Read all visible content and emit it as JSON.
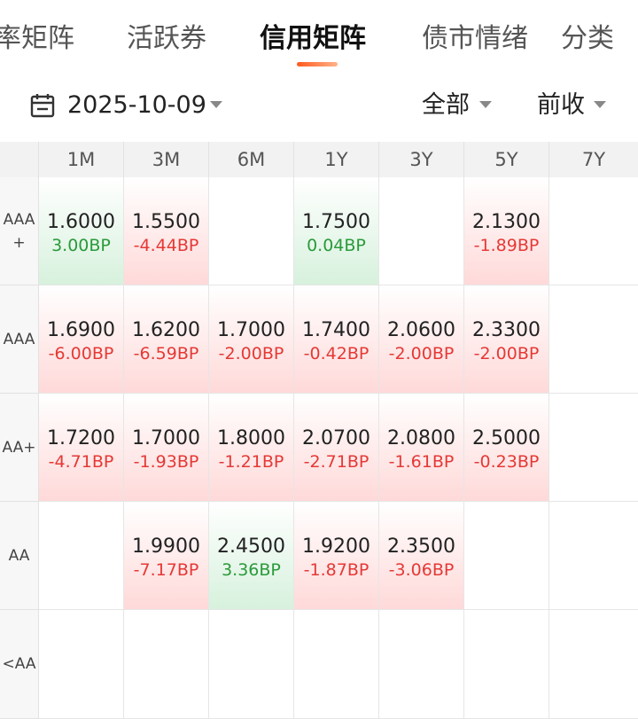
{
  "tabs": [
    {
      "label": "率矩阵",
      "active": false
    },
    {
      "label": "活跃券",
      "active": false
    },
    {
      "label": "信用矩阵",
      "active": true
    },
    {
      "label": "债市情绪",
      "active": false
    },
    {
      "label": "分类",
      "active": false
    }
  ],
  "filter": {
    "date": "2025-10-09",
    "scope": "全部",
    "compare": "前收"
  },
  "columns": [
    "1M",
    "3M",
    "6M",
    "1Y",
    "3Y",
    "5Y",
    "7Y"
  ],
  "rows": [
    {
      "label_line1": "AAA",
      "label_line2": "+",
      "cells": [
        {
          "value": "1.6000",
          "bp": "3.00BP",
          "trend": "green"
        },
        {
          "value": "1.5500",
          "bp": "-4.44BP",
          "trend": "red"
        },
        {
          "value": "",
          "bp": "",
          "trend": "none"
        },
        {
          "value": "1.7500",
          "bp": "0.04BP",
          "trend": "green"
        },
        {
          "value": "",
          "bp": "",
          "trend": "none"
        },
        {
          "value": "2.1300",
          "bp": "-1.89BP",
          "trend": "red"
        },
        {
          "value": "",
          "bp": "",
          "trend": "none"
        }
      ]
    },
    {
      "label_line1": "AAA",
      "label_line2": "",
      "cells": [
        {
          "value": "1.6900",
          "bp": "-6.00BP",
          "trend": "red"
        },
        {
          "value": "1.6200",
          "bp": "-6.59BP",
          "trend": "red"
        },
        {
          "value": "1.7000",
          "bp": "-2.00BP",
          "trend": "red"
        },
        {
          "value": "1.7400",
          "bp": "-0.42BP",
          "trend": "red"
        },
        {
          "value": "2.0600",
          "bp": "-2.00BP",
          "trend": "red"
        },
        {
          "value": "2.3300",
          "bp": "-2.00BP",
          "trend": "red"
        },
        {
          "value": "",
          "bp": "",
          "trend": "none"
        }
      ]
    },
    {
      "label_line1": "AA+",
      "label_line2": "",
      "cells": [
        {
          "value": "1.7200",
          "bp": "-4.71BP",
          "trend": "red"
        },
        {
          "value": "1.7000",
          "bp": "-1.93BP",
          "trend": "red"
        },
        {
          "value": "1.8000",
          "bp": "-1.21BP",
          "trend": "red"
        },
        {
          "value": "2.0700",
          "bp": "-2.71BP",
          "trend": "red"
        },
        {
          "value": "2.0800",
          "bp": "-1.61BP",
          "trend": "red"
        },
        {
          "value": "2.5000",
          "bp": "-0.23BP",
          "trend": "red"
        },
        {
          "value": "",
          "bp": "",
          "trend": "none"
        }
      ]
    },
    {
      "label_line1": "AA",
      "label_line2": "",
      "cells": [
        {
          "value": "",
          "bp": "",
          "trend": "none"
        },
        {
          "value": "1.9900",
          "bp": "-7.17BP",
          "trend": "red"
        },
        {
          "value": "2.4500",
          "bp": "3.36BP",
          "trend": "green"
        },
        {
          "value": "1.9200",
          "bp": "-1.87BP",
          "trend": "red"
        },
        {
          "value": "2.3500",
          "bp": "-3.06BP",
          "trend": "red"
        },
        {
          "value": "",
          "bp": "",
          "trend": "none"
        },
        {
          "value": "",
          "bp": "",
          "trend": "none"
        }
      ]
    },
    {
      "label_line1": "<AA",
      "label_line2": "",
      "cells": [
        {
          "value": "",
          "bp": "",
          "trend": "none"
        },
        {
          "value": "",
          "bp": "",
          "trend": "none"
        },
        {
          "value": "",
          "bp": "",
          "trend": "none"
        },
        {
          "value": "",
          "bp": "",
          "trend": "none"
        },
        {
          "value": "",
          "bp": "",
          "trend": "none"
        },
        {
          "value": "",
          "bp": "",
          "trend": "none"
        },
        {
          "value": "",
          "bp": "",
          "trend": "none"
        }
      ]
    }
  ],
  "colors": {
    "up_bg": "#ffd9d9",
    "down_bg": "#d7f1dd",
    "up_text": "#e53935",
    "down_text": "#2a9a3a",
    "accent": "#ff5a1f"
  }
}
